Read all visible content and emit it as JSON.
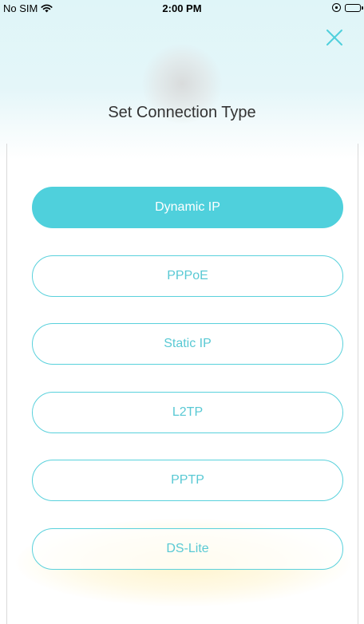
{
  "status_bar": {
    "carrier": "No SIM",
    "time": "2:00 PM"
  },
  "header": {
    "title": "Set Connection Type",
    "close_icon": "close-icon"
  },
  "options": [
    {
      "label": "Dynamic IP",
      "selected": true
    },
    {
      "label": "PPPoE",
      "selected": false
    },
    {
      "label": "Static IP",
      "selected": false
    },
    {
      "label": "L2TP",
      "selected": false
    },
    {
      "label": "PPTP",
      "selected": false
    },
    {
      "label": "DS-Lite",
      "selected": false
    }
  ],
  "colors": {
    "accent": "#4fd0dc",
    "title": "#333333"
  }
}
